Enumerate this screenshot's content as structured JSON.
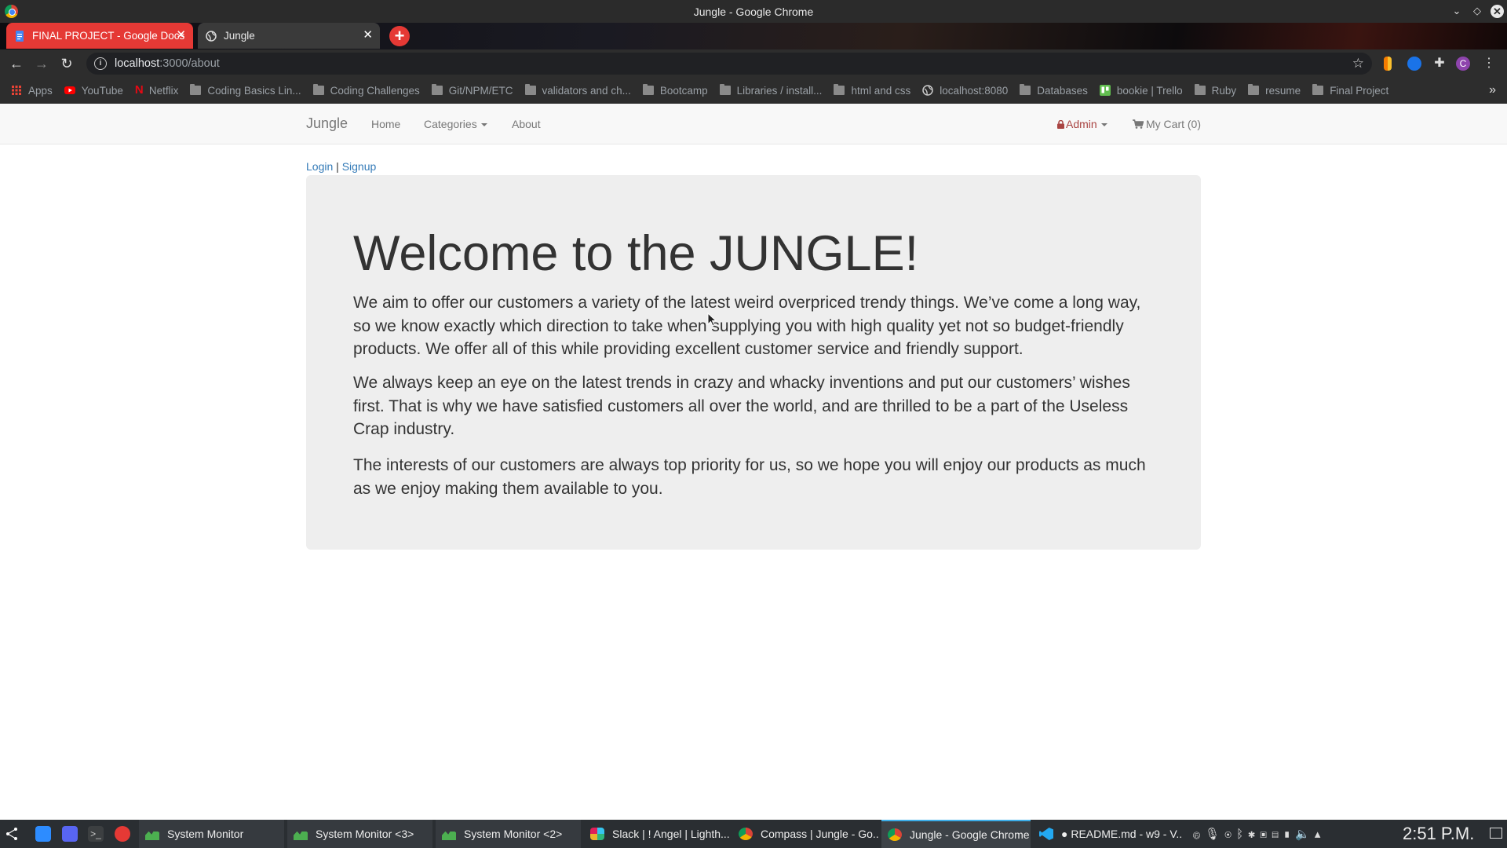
{
  "window": {
    "title": "Jungle - Google Chrome"
  },
  "tabs": [
    {
      "label": "FINAL PROJECT - Google Docs",
      "active": false,
      "color": "#e53935"
    },
    {
      "label": "Jungle",
      "active": true
    }
  ],
  "address_bar": {
    "host": "localhost",
    "path": ":3000/about"
  },
  "bookmarks": [
    {
      "label": "Apps",
      "icon": "apps-grid-icon"
    },
    {
      "label": "YouTube",
      "icon": "youtube-icon"
    },
    {
      "label": "Netflix",
      "icon": "netflix-icon"
    },
    {
      "label": "Coding Basics Lin...",
      "icon": "folder-icon"
    },
    {
      "label": "Coding Challenges",
      "icon": "folder-icon"
    },
    {
      "label": "Git/NPM/ETC",
      "icon": "folder-icon"
    },
    {
      "label": "validators and ch...",
      "icon": "folder-icon"
    },
    {
      "label": "Bootcamp",
      "icon": "folder-icon"
    },
    {
      "label": "Libraries / install...",
      "icon": "folder-icon"
    },
    {
      "label": "html and css",
      "icon": "folder-icon"
    },
    {
      "label": "localhost:8080",
      "icon": "globe-icon"
    },
    {
      "label": "Databases",
      "icon": "folder-icon"
    },
    {
      "label": "bookie | Trello",
      "icon": "trello-icon"
    },
    {
      "label": "Ruby",
      "icon": "folder-icon"
    },
    {
      "label": "resume",
      "icon": "folder-icon"
    },
    {
      "label": "Final Project",
      "icon": "folder-icon"
    }
  ],
  "navbar": {
    "brand": "Jungle",
    "home": "Home",
    "categories": "Categories",
    "about": "About",
    "admin": "Admin",
    "cart": "My Cart (0)"
  },
  "auth": {
    "login": "Login",
    "separator": "|",
    "signup": "Signup"
  },
  "about": {
    "heading": "Welcome to the JUNGLE!",
    "paragraph1": "We aim to offer our customers a variety of the latest weird overpriced trendy things. We’ve come a long way, so we know exactly which direction to take when supplying you with high quality yet not so budget-friendly products. We offer all of this while providing excellent customer service and friendly support.",
    "paragraph2": "We always keep an eye on the latest trends in crazy and whacky inventions and put our customers’ wishes first. That is why we have satisfied customers all over the world, and are thrilled to be a part of the Useless Crap industry.",
    "paragraph3": "The interests of our customers are always top priority for us, so we hope you will enjoy our products as much as we enjoy making them available to you."
  },
  "taskbar": {
    "tasks": [
      {
        "label": "System Monitor"
      },
      {
        "label": "System Monitor <3>"
      },
      {
        "label": "System Monitor <2>"
      },
      {
        "label": "Slack | ! Angel | Lighth..."
      },
      {
        "label": "Compass | Jungle - Go..."
      },
      {
        "label": "Jungle - Google Chrome"
      },
      {
        "label": "● README.md - w9 - V..."
      }
    ],
    "clock": "2:51 P.M."
  },
  "colors": {
    "accent_tab": "#e53935",
    "link": "#337ab7",
    "admin": "#a94442",
    "jumbotron_bg": "#eeeeee"
  }
}
